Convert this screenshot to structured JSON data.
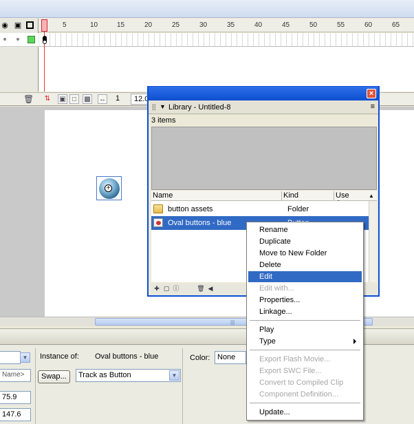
{
  "timeline": {
    "frame_numbers": [
      "1",
      "5",
      "10",
      "15",
      "20",
      "25",
      "30",
      "35",
      "40",
      "45",
      "50",
      "55",
      "60",
      "65"
    ],
    "current_frame": "1",
    "frame_rate": "12.0"
  },
  "library": {
    "title": "Library - Untitled-8",
    "item_count": "3 items",
    "columns": {
      "name": "Name",
      "kind": "Kind",
      "use_count": "Use Coun"
    },
    "items": [
      {
        "name": "button assets",
        "kind": "Folder"
      },
      {
        "name": "Oval buttons - blue",
        "kind": "Button"
      }
    ]
  },
  "context_menu": {
    "items": [
      {
        "label": "Rename",
        "enabled": true
      },
      {
        "label": "Duplicate",
        "enabled": true
      },
      {
        "label": "Move to New Folder",
        "enabled": true
      },
      {
        "label": "Delete",
        "enabled": true
      },
      {
        "label": "Edit",
        "enabled": true,
        "highlighted": true
      },
      {
        "label": "Edit with...",
        "enabled": false
      },
      {
        "label": "Properties...",
        "enabled": true
      },
      {
        "label": "Linkage...",
        "enabled": true
      },
      {
        "label": "Play",
        "enabled": true
      },
      {
        "label": "Type",
        "enabled": true,
        "submenu": true
      },
      {
        "label": "Export Flash Movie...",
        "enabled": false
      },
      {
        "label": "Export SWC File...",
        "enabled": false
      },
      {
        "label": "Convert to Compiled Clip",
        "enabled": false
      },
      {
        "label": "Component Definition...",
        "enabled": false
      },
      {
        "label": "Update...",
        "enabled": true
      }
    ]
  },
  "properties": {
    "instance_name_placeholder": "Name>",
    "instance_of_label": "Instance of:",
    "instance_of_value": "Oval buttons - blue",
    "swap_label": "Swap...",
    "track_value": "Track as Button",
    "color_label": "Color:",
    "color_value": "None",
    "width_value": "75.9",
    "height_value": "147.6"
  }
}
